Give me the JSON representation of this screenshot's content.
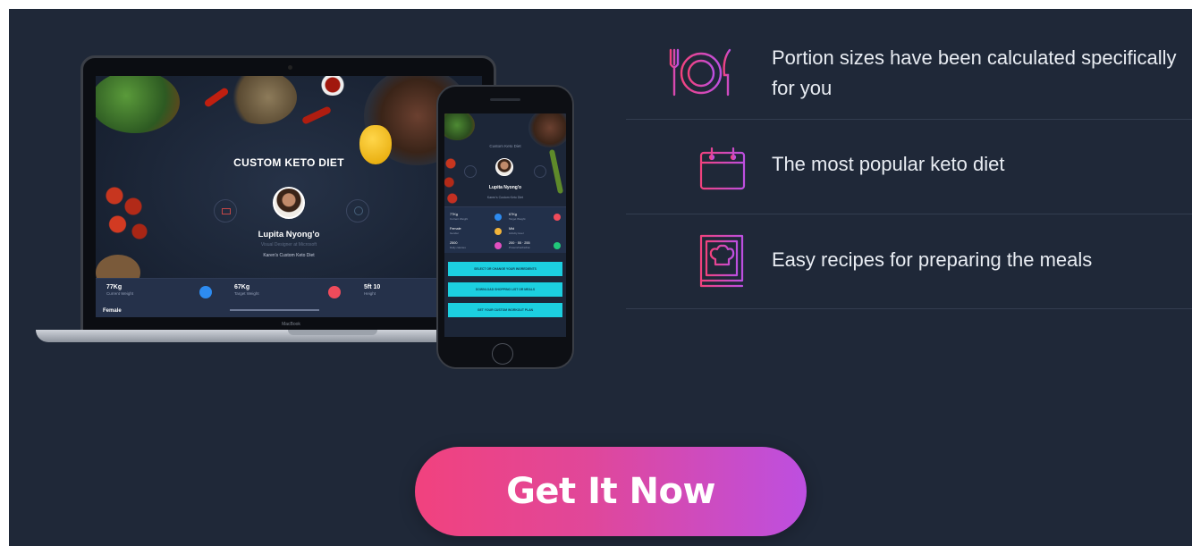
{
  "laptop": {
    "screen_title": "CUSTOM KETO DIET",
    "user_name": "Lupita Nyong'o",
    "user_subtitle": "Visual Designer at Microsoft",
    "plan_label": "Karen's Custom Keto Diet",
    "brand": "MacBook",
    "stats": [
      {
        "value": "77Kg",
        "label": "Current Weight",
        "color": "#2d8bf0"
      },
      {
        "value": "67Kg",
        "label": "Target Weight",
        "color": "#ef4b5b"
      },
      {
        "value": "5ft 10",
        "label": "Height"
      }
    ],
    "row2_label": "Female"
  },
  "phone": {
    "screen_title": "Custom Keto Diet",
    "user_name": "Lupita Nyong'o",
    "plan_label": "Karen's Custom Keto Diet",
    "stats": [
      {
        "value": "77Kg",
        "label": "Current Weight",
        "color": "#2d8bf0"
      },
      {
        "value": "67Kg",
        "label": "Target Weight",
        "color": "#ef4b5b"
      },
      {
        "value": "Female",
        "label": "Gender",
        "color": "#f3b43a"
      },
      {
        "value": "Mid",
        "label": "Activity level"
      },
      {
        "value": "2500",
        "label": "Daily calories",
        "color": "#e24fc0"
      },
      {
        "value": "200 · 55 · 255",
        "label": "Protein/Carbs/Fat",
        "color": "#21c87a"
      }
    ],
    "buttons": [
      "SELECT OR CHANGE YOUR INGREDIENTS",
      "DOWNLOAD SHOPPING LIST OR MEALS",
      "GET YOUR CUSTOM WORKOUT PLAN"
    ]
  },
  "features": [
    {
      "icon": "plate-fork-knife-icon",
      "text": "Portion sizes have been calculated specifically for you"
    },
    {
      "icon": "calendar-icon",
      "text": "The most popular keto diet"
    },
    {
      "icon": "recipe-book-chef-hat-icon",
      "text": "Easy recipes for preparing the meals"
    }
  ],
  "cta": {
    "label": "Get It Now"
  },
  "colors": {
    "background": "#1f2838",
    "accent_pink": "#f1427e",
    "accent_purple": "#bd4fe0",
    "icon_stroke": "#e0479a"
  }
}
